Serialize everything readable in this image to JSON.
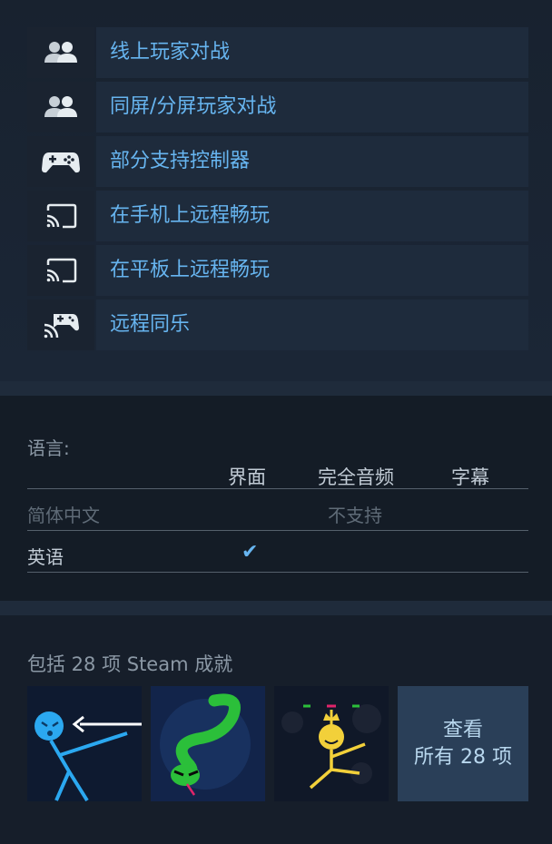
{
  "features": [
    {
      "label": "线上玩家对战",
      "icon": "multiplayer-icon"
    },
    {
      "label": "同屏/分屏玩家对战",
      "icon": "multiplayer-icon"
    },
    {
      "label": "部分支持控制器",
      "icon": "gamepad-icon"
    },
    {
      "label": "在手机上远程畅玩",
      "icon": "cast-icon"
    },
    {
      "label": "在平板上远程畅玩",
      "icon": "cast-icon"
    },
    {
      "label": "远程同乐",
      "icon": "remote-play-together-icon"
    }
  ],
  "languages": {
    "title": "语言:",
    "columns": [
      "界面",
      "完全音频",
      "字幕"
    ],
    "rows": [
      {
        "name": "简体中文",
        "note": "不支持"
      },
      {
        "name": "英语",
        "interface": "✔"
      }
    ]
  },
  "achievements": {
    "title": "包括 28 项 Steam 成就",
    "view_all_line1": "查看",
    "view_all_line2": "所有 28 项"
  },
  "colors": {
    "accent_blue": "#67b5f0",
    "background": "#17202d"
  }
}
